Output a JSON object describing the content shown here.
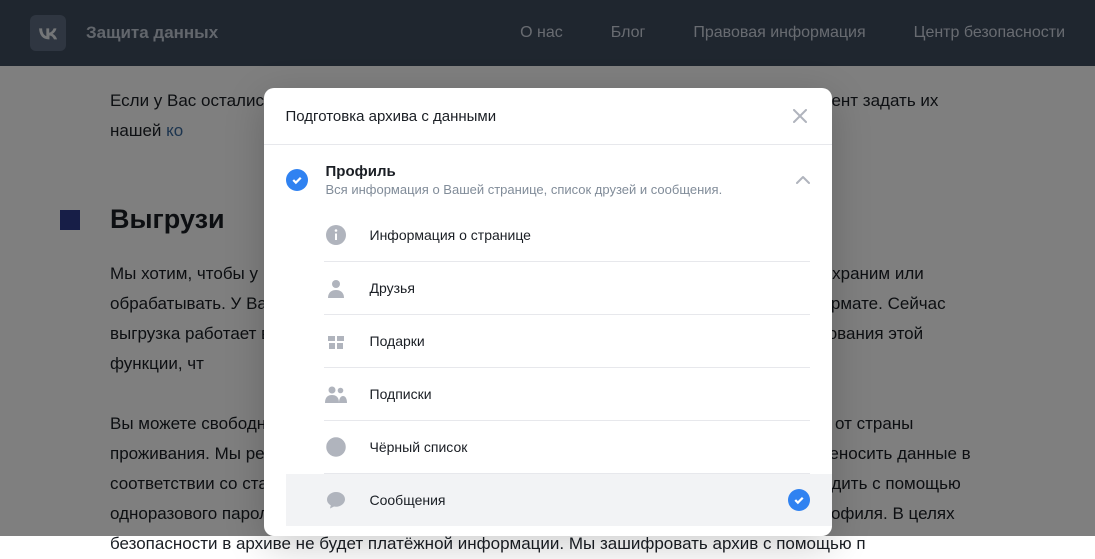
{
  "header": {
    "brand": "Защита данных",
    "nav": [
      "О нас",
      "Блог",
      "Правовая информация",
      "Центр безопасности"
    ]
  },
  "page": {
    "intro_part1": "Если у Вас остались вопросы касательно приватности ВКонтакте, Вы можете в любой момент задать их нашей ",
    "intro_link": "ко",
    "section_title": "Выгрузи",
    "p1": "Мы хотим, чтобы у Вас была возможность свободно распоряжаться данными, которые мы храним или обрабатывать. У Вас есть возможность запросить выгрузку данных в машиночитаемом формате. Сейчас выгрузка работает в ограниченном режиме. Мы работаем над улучшением и совершенствования этой функции, чт",
    "p2": "Вы можете свободно запросить выгрузку данных в машиночитаемом формате независимо от страны проживания. Мы реализовали единую систему инструментов и создадим возможность переносить данные в соответствии со стандартами. Запросить выгрузку данных очень просто, но нужно подтвердить с помощью одноразового пароля. Вы сможете скачать архив с информацией, но открыть из другого профиля. В целях безопасности в архиве не будет платёжной информации. Мы зашифровать архив с помощью п"
  },
  "modal": {
    "title": "Подготовка архива с данными",
    "section": {
      "name": "Профиль",
      "desc": "Вся информация о Вашей странице, список друзей и сообщения."
    },
    "items": [
      {
        "label": "Информация о странице",
        "icon": "info",
        "selected": false
      },
      {
        "label": "Друзья",
        "icon": "user",
        "selected": false
      },
      {
        "label": "Подарки",
        "icon": "gift",
        "selected": false
      },
      {
        "label": "Подписки",
        "icon": "group",
        "selected": false
      },
      {
        "label": "Чёрный список",
        "icon": "block",
        "selected": false
      },
      {
        "label": "Сообщения",
        "icon": "message",
        "selected": true
      }
    ]
  }
}
